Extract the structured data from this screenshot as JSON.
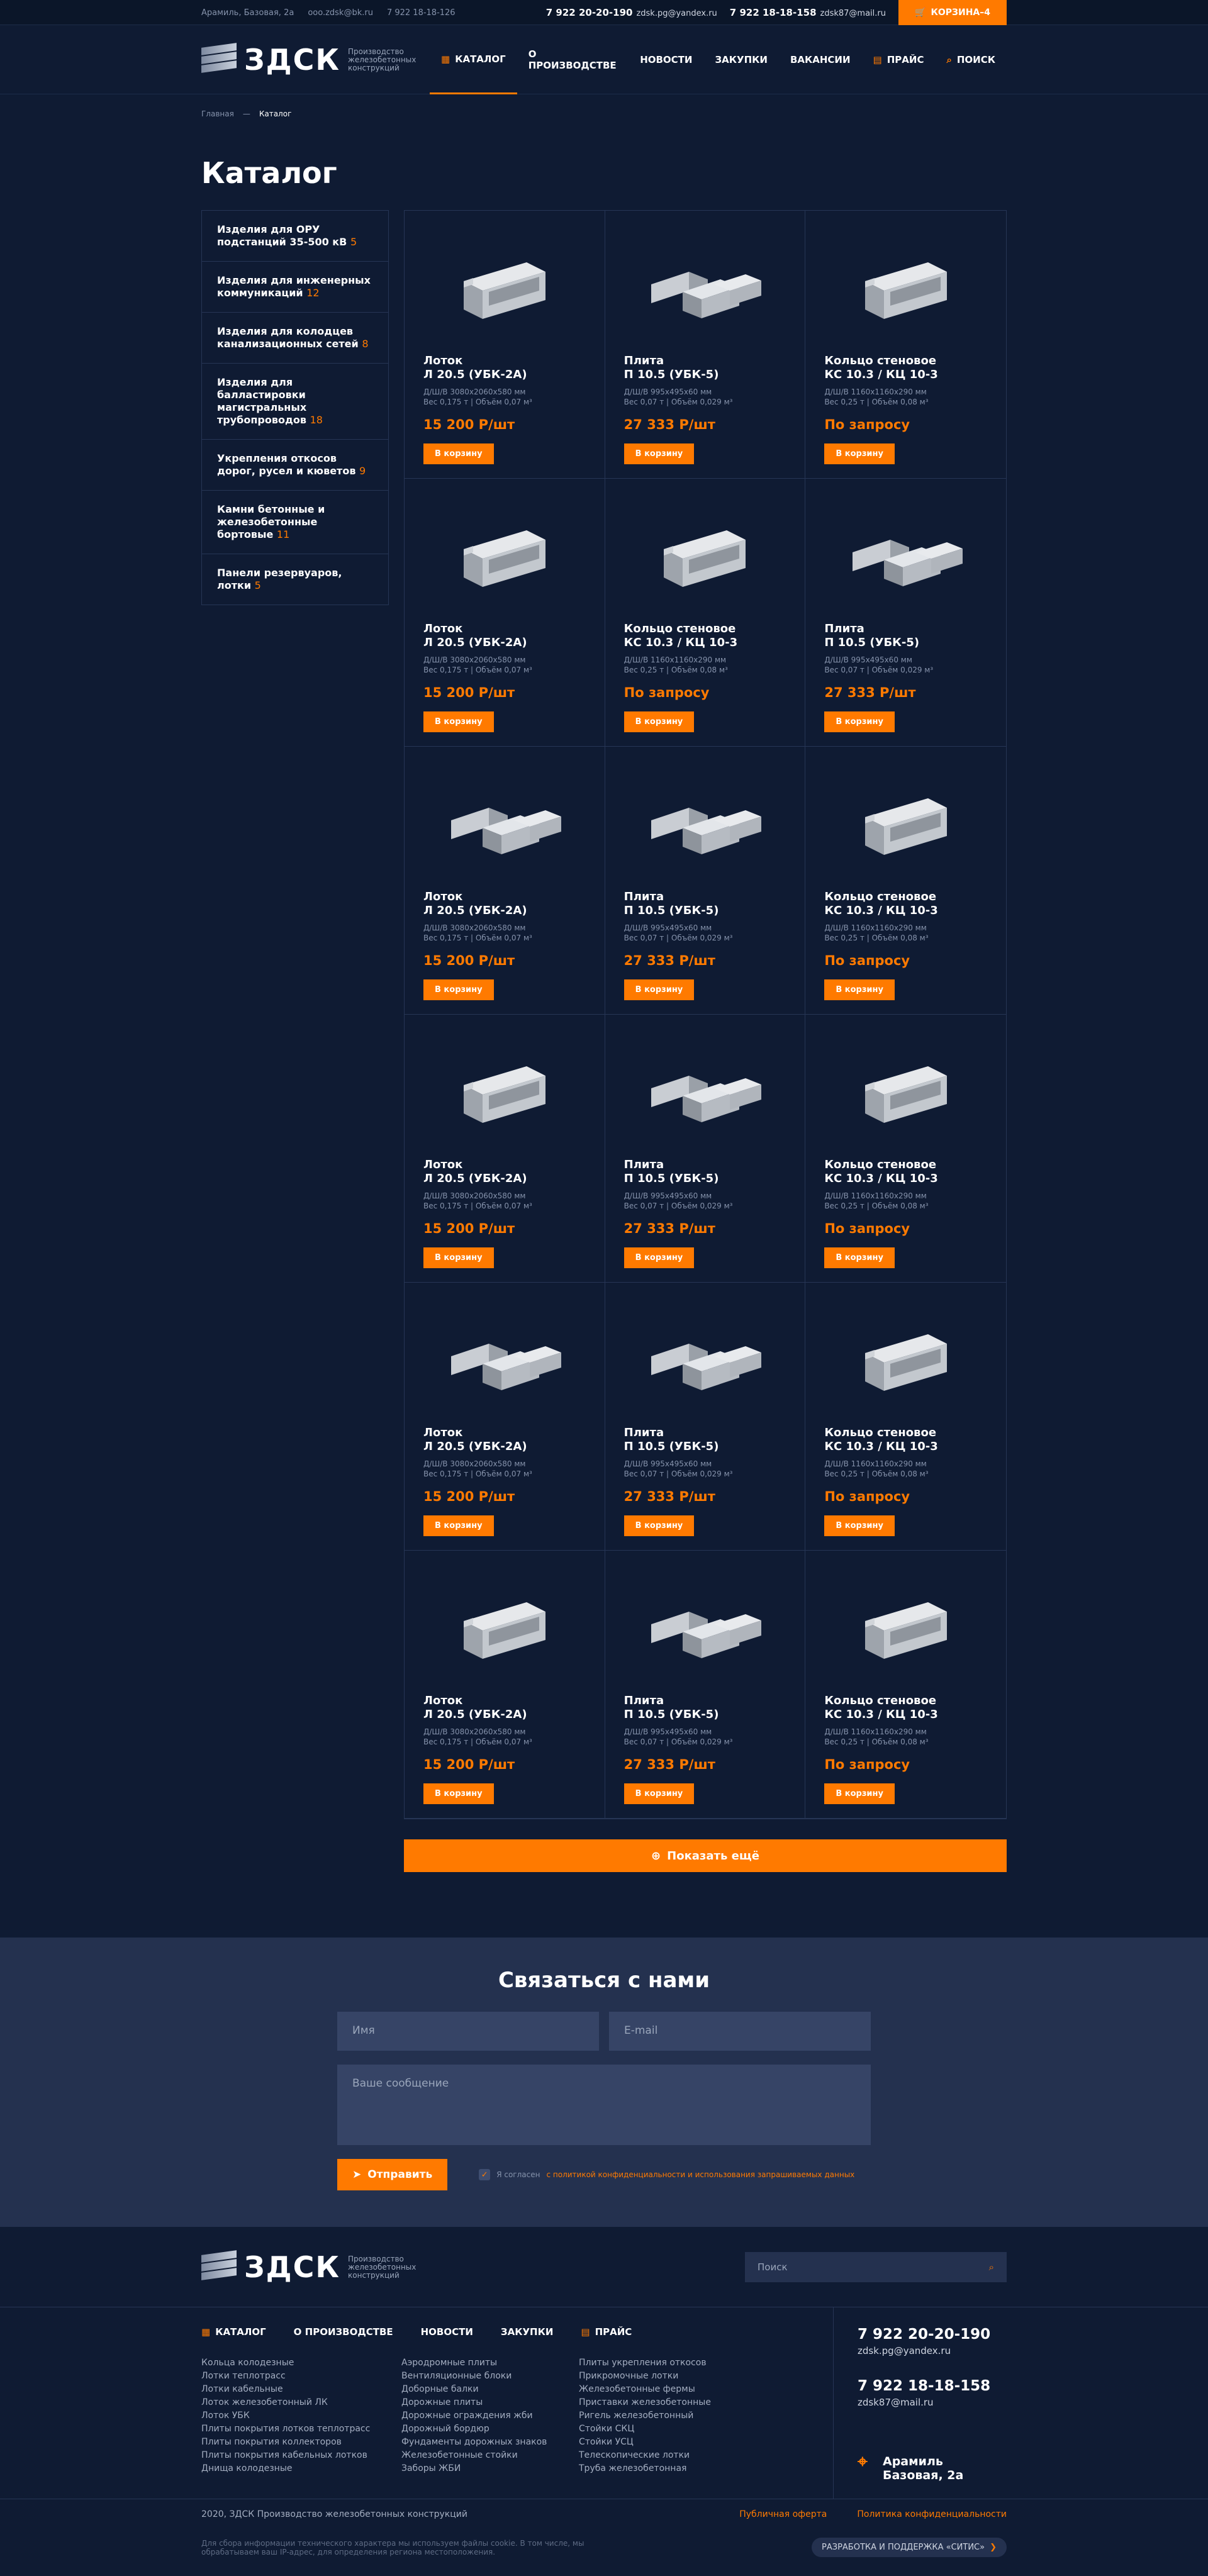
{
  "topbar": {
    "address": "Арамиль, Базовая, 2а",
    "email": "ooo.zdsk@bk.ru",
    "phone_small": "7 922 18-18-126",
    "phone1": "7 922 20-20-190",
    "mail1": "zdsk.pg@yandex.ru",
    "phone2": "7 922 18-18-158",
    "mail2": "zdsk87@mail.ru",
    "cart": "КОРЗИНА–4"
  },
  "logo": {
    "name": "ЗДСК",
    "subtitle": "Производство железобетонных конструкций"
  },
  "nav": [
    "Каталог",
    "О производстве",
    "Новости",
    "Закупки",
    "Вакансии",
    "Прайс",
    "Поиск"
  ],
  "breadcrumbs": [
    "Главная",
    "Каталог"
  ],
  "page_title": "Каталог",
  "sidebar": [
    {
      "label": "Изделия для ОРУ подстанций 35-500 кВ",
      "count": "5"
    },
    {
      "label": "Изделия для инженерных коммуникаций",
      "count": "12"
    },
    {
      "label": "Изделия для колодцев канализационных сетей",
      "count": "8"
    },
    {
      "label": "Изделия для балластировки магистральных трубопроводов",
      "count": "18"
    },
    {
      "label": "Укрепления откосов дорог, русел и кюветов",
      "count": "9"
    },
    {
      "label": "Камни бетонные и железобетонные бортовые",
      "count": "11"
    },
    {
      "label": "Панели резервуаров, лотки",
      "count": "5"
    }
  ],
  "products": [
    {
      "name": "Лоток",
      "model": "Л 20.5 (УБК-2А)",
      "dims": "Д/Ш/В 3080х2060х580 мм",
      "weight": "Вес 0,175 т",
      "volume": "Объём 0,07 м³",
      "price": "15 200 Р/шт",
      "btn": "В корзину",
      "shape": "trough"
    },
    {
      "name": "Плита",
      "model": "П 10.5 (УБК-5)",
      "dims": "Д/Ш/В 995х495х60 мм",
      "weight": "Вес 0,07 т",
      "volume": "Объём 0,029 м³",
      "price": "27 333 Р/шт",
      "btn": "В корзину",
      "shape": "slabs"
    },
    {
      "name": "Кольцо стеновое",
      "model": "КС 10.3 / КЦ 10-3",
      "dims": "Д/Ш/В 1160х1160х290 мм",
      "weight": "Вес 0,25 т",
      "volume": "Объём 0,08 м³",
      "price": "По запросу",
      "btn": "В корзину",
      "shape": "trough"
    },
    {
      "name": "Лоток",
      "model": "Л 20.5 (УБК-2А)",
      "dims": "Д/Ш/В 3080х2060х580 мм",
      "weight": "Вес 0,175 т",
      "volume": "Объём 0,07 м³",
      "price": "15 200 Р/шт",
      "btn": "В корзину",
      "shape": "trough"
    },
    {
      "name": "Кольцо стеновое",
      "model": "КС 10.3 / КЦ 10-3",
      "dims": "Д/Ш/В 1160х1160х290 мм",
      "weight": "Вес 0,25 т",
      "volume": "Объём 0,08 м³",
      "price": "По запросу",
      "btn": "В корзину",
      "shape": "trough"
    },
    {
      "name": "Плита",
      "model": "П 10.5 (УБК-5)",
      "dims": "Д/Ш/В 995х495х60 мм",
      "weight": "Вес 0,07 т",
      "volume": "Объём 0,029 м³",
      "price": "27 333 Р/шт",
      "btn": "В корзину",
      "shape": "slabs"
    },
    {
      "name": "Лоток",
      "model": "Л 20.5 (УБК-2А)",
      "dims": "Д/Ш/В 3080х2060х580 мм",
      "weight": "Вес 0,175 т",
      "volume": "Объём 0,07 м³",
      "price": "15 200 Р/шт",
      "btn": "В корзину",
      "shape": "slabs"
    },
    {
      "name": "Плита",
      "model": "П 10.5 (УБК-5)",
      "dims": "Д/Ш/В 995х495х60 мм",
      "weight": "Вес 0,07 т",
      "volume": "Объём 0,029 м³",
      "price": "27 333 Р/шт",
      "btn": "В корзину",
      "shape": "slabs"
    },
    {
      "name": "Кольцо стеновое",
      "model": "КС 10.3 / КЦ 10-3",
      "dims": "Д/Ш/В 1160х1160х290 мм",
      "weight": "Вес 0,25 т",
      "volume": "Объём 0,08 м³",
      "price": "По запросу",
      "btn": "В корзину",
      "shape": "trough"
    },
    {
      "name": "Лоток",
      "model": "Л 20.5 (УБК-2А)",
      "dims": "Д/Ш/В 3080х2060х580 мм",
      "weight": "Вес 0,175 т",
      "volume": "Объём 0,07 м³",
      "price": "15 200 Р/шт",
      "btn": "В корзину",
      "shape": "trough"
    },
    {
      "name": "Плита",
      "model": "П 10.5 (УБК-5)",
      "dims": "Д/Ш/В 995х495х60 мм",
      "weight": "Вес 0,07 т",
      "volume": "Объём 0,029 м³",
      "price": "27 333 Р/шт",
      "btn": "В корзину",
      "shape": "slabs"
    },
    {
      "name": "Кольцо стеновое",
      "model": "КС 10.3 / КЦ 10-3",
      "dims": "Д/Ш/В 1160х1160х290 мм",
      "weight": "Вес 0,25 т",
      "volume": "Объём 0,08 м³",
      "price": "По запросу",
      "btn": "В корзину",
      "shape": "trough"
    },
    {
      "name": "Лоток",
      "model": "Л 20.5 (УБК-2А)",
      "dims": "Д/Ш/В 3080х2060х580 мм",
      "weight": "Вес 0,175 т",
      "volume": "Объём 0,07 м³",
      "price": "15 200 Р/шт",
      "btn": "В корзину",
      "shape": "slabs"
    },
    {
      "name": "Плита",
      "model": "П 10.5 (УБК-5)",
      "dims": "Д/Ш/В 995х495х60 мм",
      "weight": "Вес 0,07 т",
      "volume": "Объём 0,029 м³",
      "price": "27 333 Р/шт",
      "btn": "В корзину",
      "shape": "slabs"
    },
    {
      "name": "Кольцо стеновое",
      "model": "КС 10.3 / КЦ 10-3",
      "dims": "Д/Ш/В 1160х1160х290 мм",
      "weight": "Вес 0,25 т",
      "volume": "Объём 0,08 м³",
      "price": "По запросу",
      "btn": "В корзину",
      "shape": "trough"
    },
    {
      "name": "Лоток",
      "model": "Л 20.5 (УБК-2А)",
      "dims": "Д/Ш/В 3080х2060х580 мм",
      "weight": "Вес 0,175 т",
      "volume": "Объём 0,07 м³",
      "price": "15 200 Р/шт",
      "btn": "В корзину",
      "shape": "trough"
    },
    {
      "name": "Плита",
      "model": "П 10.5 (УБК-5)",
      "dims": "Д/Ш/В 995х495х60 мм",
      "weight": "Вес 0,07 т",
      "volume": "Объём 0,029 м³",
      "price": "27 333 Р/шт",
      "btn": "В корзину",
      "shape": "slabs"
    },
    {
      "name": "Кольцо стеновое",
      "model": "КС 10.3 / КЦ 10-3",
      "dims": "Д/Ш/В 1160х1160х290 мм",
      "weight": "Вес 0,25 т",
      "volume": "Объём 0,08 м³",
      "price": "По запросу",
      "btn": "В корзину",
      "shape": "trough"
    }
  ],
  "show_more": "Показать ещё",
  "contact": {
    "title": "Связаться с нами",
    "name_ph": "Имя",
    "email_ph": "E-mail",
    "msg_ph": "Ваше сообщение",
    "send": "Отправить",
    "agree_text": "Я согласен",
    "agree_link": "с политикой конфиденциальности и использования запрашиваемых данных"
  },
  "footer": {
    "search_ph": "Поиск",
    "nav": [
      "Каталог",
      "О производстве",
      "Новости",
      "Закупки",
      "Прайс"
    ],
    "col1": [
      "Кольца колодезные",
      "Лотки теплотрасс",
      "Лотки кабельные",
      "Лоток железобетонный ЛК",
      "Лоток УБК",
      "Плиты покрытия лотков теплотрасс",
      "Плиты покрытия коллекторов",
      "Плиты покрытия кабельных лотков",
      "Днища колодезные"
    ],
    "col2": [
      "Аэродромные плиты",
      "Вентиляционные блоки",
      "Доборные балки",
      "Дорожные плиты",
      "Дорожные ограждения жби",
      "Дорожный бордюр",
      "Фундаменты дорожных знаков",
      "Железобетонные стойки",
      "Заборы ЖБИ"
    ],
    "col3": [
      "Плиты укрепления откосов",
      "Прикромочные лотки",
      "Железобетонные фермы",
      "Приставки железобетонные",
      "Ригель железобетонный",
      "Стойки СКЦ",
      "Стойки УСЦ",
      "Телескопические лотки",
      "Труба железобетонная"
    ],
    "phone1": "7 922 20-20-190",
    "mail1": "zdsk.pg@yandex.ru",
    "phone2": "7 922 18-18-158",
    "mail2": "zdsk87@mail.ru",
    "address": "Арамиль Базовая, 2а",
    "copyright": "2020, ЗДСК Производство железобетонных конструкций",
    "offer": "Публичная оферта",
    "privacy": "Политика конфиденциальности",
    "cookie": "Для сбора информации технического характера мы используем файлы cookie. В том числе, мы обрабатываем ваш IP-адрес, для определения региона местоположения.",
    "dev": "РАЗРАБОТКА И ПОДДЕРЖКА «СИТИС»"
  }
}
